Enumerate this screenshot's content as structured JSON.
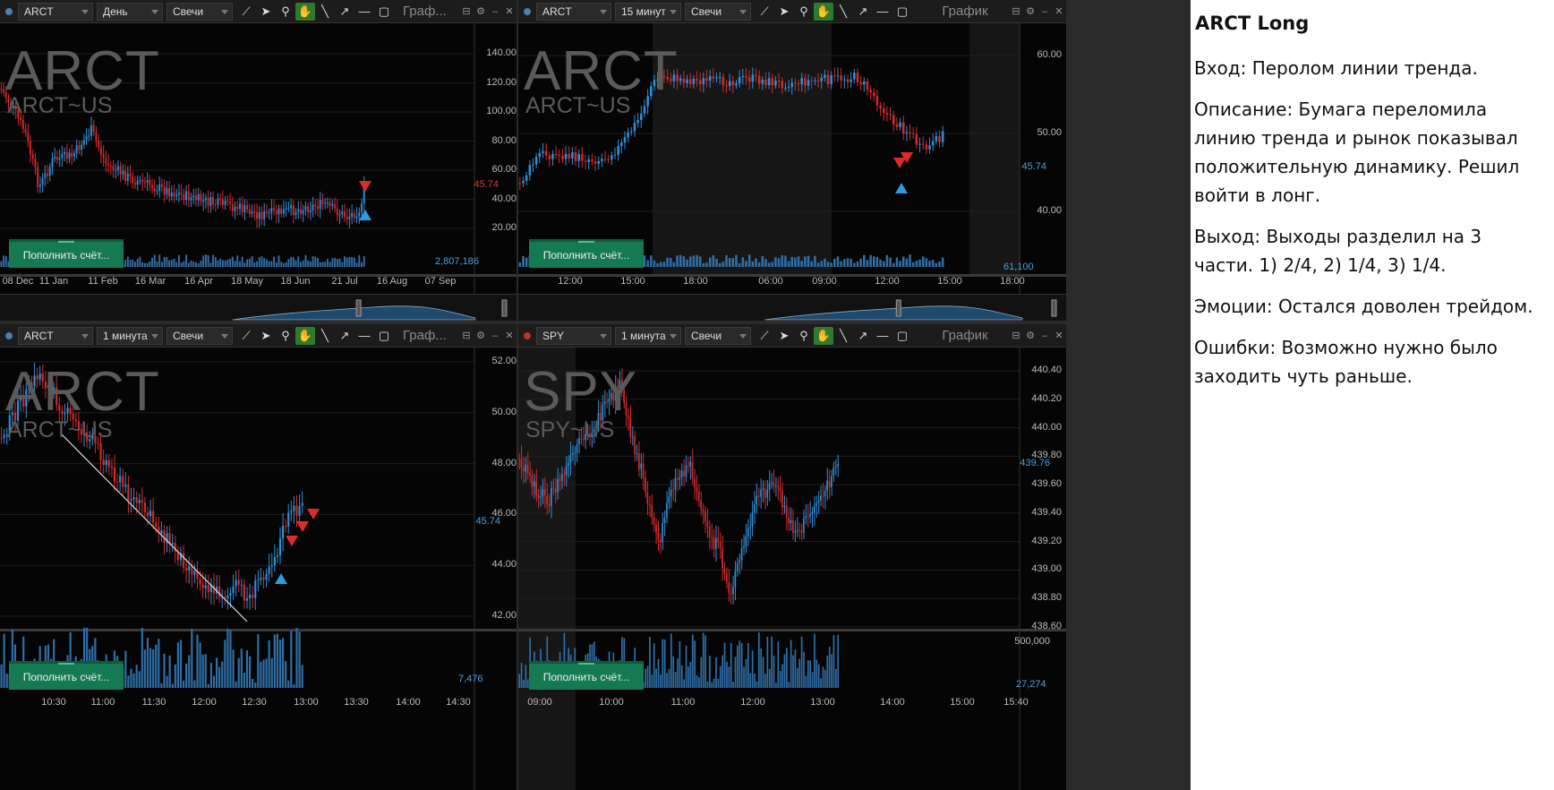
{
  "panels": [
    {
      "symbol": "ARCT",
      "interval": "День",
      "chart_type": "Свечи",
      "label": "Граф...",
      "wm_big": "ARCT",
      "wm_small": "ARCT~US",
      "dot": "blue",
      "y_ticks": [
        "140.00",
        "120.00",
        "100.00",
        "80.00",
        "60.00",
        "40.00",
        "20.00"
      ],
      "price_label": "45.74",
      "x_ticks": [
        "08 Dec",
        "11 Jan",
        "11 Feb",
        "16 Mar",
        "16 Apr",
        "18 May",
        "18 Jun",
        "21 Jul",
        "16 Aug",
        "07 Sep"
      ],
      "deposit": "Пополнить счёт...",
      "volume": "2,807,186"
    },
    {
      "symbol": "ARCT",
      "interval": "15 минут",
      "chart_type": "Свечи",
      "label": "График",
      "wm_big": "ARCT",
      "wm_small": "ARCT~US",
      "dot": "blue",
      "y_ticks": [
        "60.00",
        "50.00",
        "40.00"
      ],
      "price_label": "45.74",
      "x_ticks": [
        "12:00",
        "15:00",
        "18:00",
        "06:00",
        "09:00",
        "12:00",
        "15:00",
        "18:00"
      ],
      "deposit": "Пополнить счёт...",
      "volume": "61,100"
    },
    {
      "symbol": "ARCT",
      "interval": "1 минута",
      "chart_type": "Свечи",
      "label": "Граф...",
      "wm_big": "ARCT",
      "wm_small": "ARCT~US",
      "dot": "blue",
      "y_ticks": [
        "52.00",
        "50.00",
        "48.00",
        "46.00",
        "44.00",
        "42.00"
      ],
      "price_label": "45.74",
      "x_ticks": [
        "10:30",
        "11:00",
        "11:30",
        "12:00",
        "12:30",
        "13:00",
        "13:30",
        "14:00",
        "14:30"
      ],
      "deposit": "Пополнить счёт...",
      "volume": "7,476"
    },
    {
      "symbol": "SPY",
      "interval": "1 минута",
      "chart_type": "Свечи",
      "label": "График",
      "wm_big": "SPY",
      "wm_small": "SPY~US",
      "dot": "red",
      "y_ticks": [
        "440.40",
        "440.20",
        "440.00",
        "439.80",
        "439.60",
        "439.40",
        "439.20",
        "439.00",
        "438.80",
        "438.60"
      ],
      "price_label": "439.76",
      "x_ticks": [
        "09:00",
        "10:00",
        "11:00",
        "12:00",
        "13:00",
        "14:00",
        "15:00",
        "15:40"
      ],
      "deposit": "Пополнить счёт...",
      "volume": "27,274",
      "volume_top": "500,000"
    }
  ],
  "notes": {
    "title": "ARCT Long",
    "entry": "Вход: Перолом линии тренда.",
    "description": "Описание: Бумага переломила линию тренда и рынок показывал положительную динамику. Решил войти в лонг.",
    "exit": "Выход: Выходы разделил на 3 части. 1) 2/4, 2) 1/4, 3) 1/4.",
    "emotions": "Эмоции: Остался доволен трейдом.",
    "mistakes": "Ошибки: Возможно нужно было заходить чуть раньше."
  },
  "colors": {
    "up": "#2f8fd8",
    "down": "#d42a2a",
    "bg": "#050505",
    "deposit": "#157a52"
  }
}
